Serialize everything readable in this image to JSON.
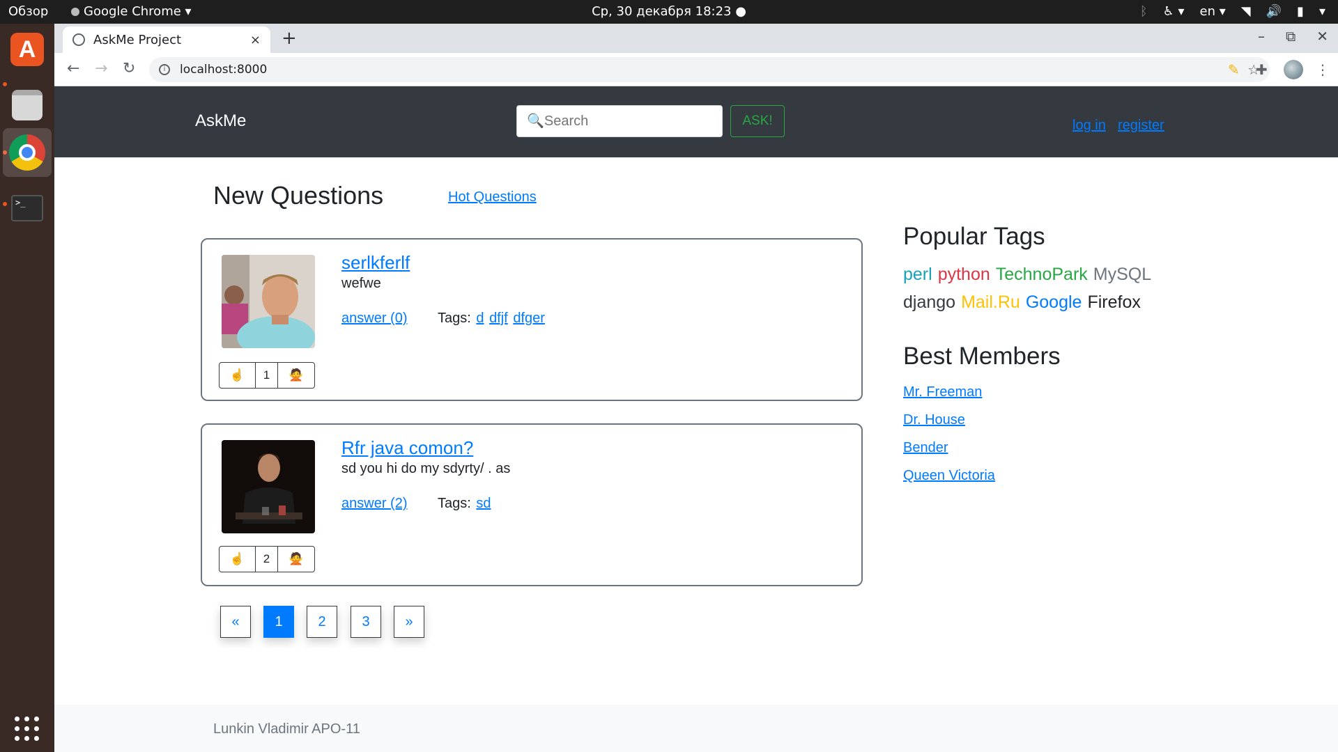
{
  "system": {
    "overview": "Обзор",
    "app_menu": "Google Chrome ▾",
    "clock": "Ср, 30 декабря  18:23  ●",
    "lang": "en ▾",
    "tray_icons": [
      "bluetooth-icon",
      "accessibility-icon",
      "wifi-icon",
      "volume-icon",
      "battery-icon",
      "power-menu-icon"
    ]
  },
  "dock": {
    "items": [
      "software-center-icon",
      "files-icon",
      "chrome-icon",
      "terminal-icon",
      "app-grid-icon"
    ],
    "terminal_glyph": ">_"
  },
  "browser": {
    "tab_title": "AskMe Project",
    "tab_close": "×",
    "new_tab": "+",
    "url": "localhost:8000",
    "win_min": "–",
    "win_restore": "⧉",
    "win_close": "✕"
  },
  "site": {
    "brand": "AskMe",
    "search_placeholder": "🔍Search",
    "ask_label": "ASK!",
    "login": "log in",
    "register": "register"
  },
  "main": {
    "heading": "New Questions",
    "hot_link": "Hot Questions",
    "questions": [
      {
        "title": "serlkferlf",
        "text": "wefwe",
        "answer": "answer (0)",
        "tags_label": "Tags:",
        "tags": [
          "d",
          "dfjf",
          "dfger"
        ],
        "votes": "1",
        "up": "☝",
        "down": "🙅"
      },
      {
        "title": "Rfr java comon?",
        "text": "sd you hi do my sdyrty/ . as",
        "answer": "answer (2)",
        "tags_label": "Tags:",
        "tags": [
          "sd"
        ],
        "votes": "2",
        "up": "☝",
        "down": "🙅"
      }
    ],
    "pagination": [
      "«",
      "1",
      "2",
      "3",
      "»"
    ],
    "current_page": "1"
  },
  "sidebar": {
    "tags_heading": "Popular Tags",
    "tags": [
      {
        "name": "perl",
        "color": "#17a2b8"
      },
      {
        "name": "python",
        "color": "#dc3545"
      },
      {
        "name": "TechnoPark",
        "color": "#28a745"
      },
      {
        "name": "MySQL",
        "color": "#6c757d"
      },
      {
        "name": "django",
        "color": "#343a40"
      },
      {
        "name": "Mail.Ru",
        "color": "#ffc107"
      },
      {
        "name": "Google",
        "color": "#007bff"
      },
      {
        "name": "Firefox",
        "color": "#212529"
      }
    ],
    "members_heading": "Best Members",
    "members": [
      "Mr. Freeman",
      "Dr. House",
      "Bender",
      "Queen Victoria"
    ]
  },
  "footer": {
    "text": "Lunkin Vladimir APO-11"
  }
}
